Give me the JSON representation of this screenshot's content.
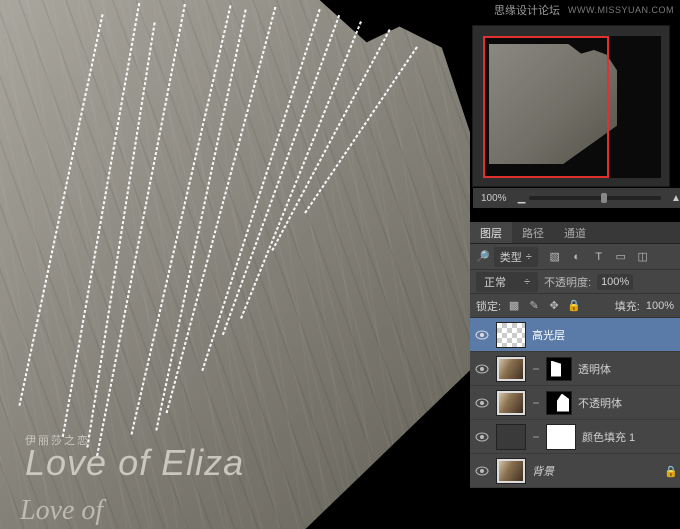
{
  "watermark": {
    "site_cn": "思缘设计论坛",
    "site_en": "WWW.MISSYUAN.COM"
  },
  "canvas": {
    "love_prefix": "伊丽莎之恋",
    "love_line": "Love of Eliza",
    "love_line2": "Love of"
  },
  "navigator": {
    "zoom": "100%"
  },
  "panel": {
    "tabs": {
      "layers": "图层",
      "paths": "路径",
      "channels": "通道"
    },
    "filter_label": "类型",
    "blend_mode": "正常",
    "opacity_label": "不透明度:",
    "opacity_value": "100%",
    "lock_label": "锁定:",
    "fill_label": "填充:",
    "fill_value": "100%",
    "layers": [
      {
        "name": "高光层"
      },
      {
        "name": "透明体"
      },
      {
        "name": "不透明体"
      },
      {
        "name": "颜色填充 1"
      },
      {
        "name": "背景"
      }
    ]
  }
}
